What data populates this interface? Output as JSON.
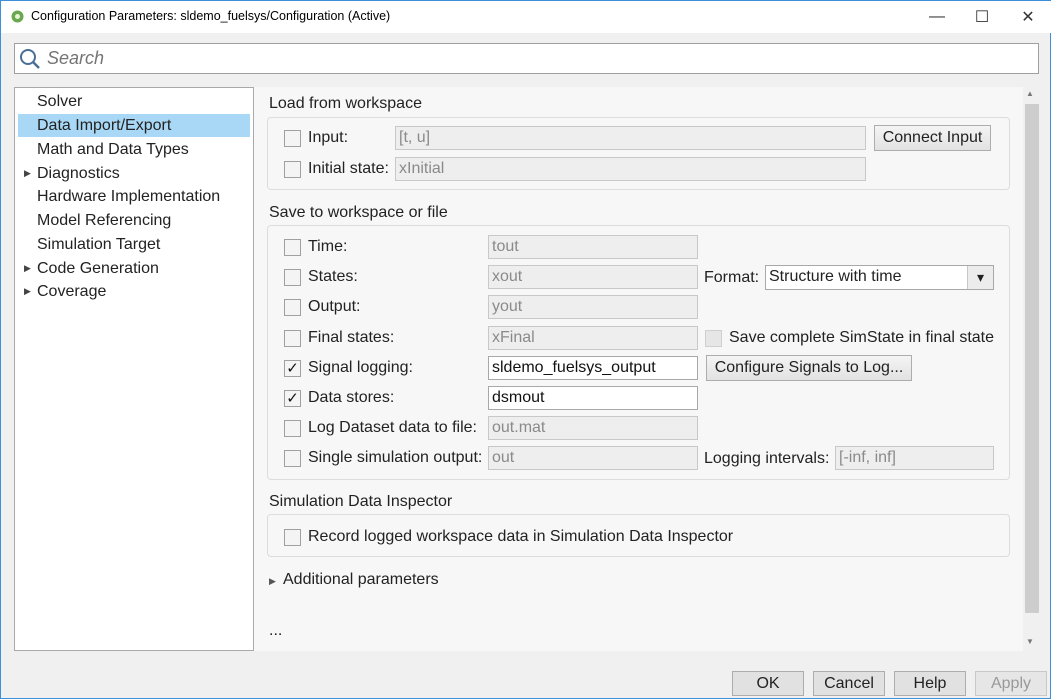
{
  "window": {
    "title": "Configuration Parameters: sldemo_fuelsys/Configuration (Active)",
    "minimize": "—",
    "maximize": "☐",
    "close": "✕"
  },
  "search": {
    "placeholder": "Search"
  },
  "tree": [
    {
      "label": "Solver",
      "arrow": ""
    },
    {
      "label": "Data Import/Export",
      "arrow": "",
      "selected": true
    },
    {
      "label": "Math and Data Types",
      "arrow": ""
    },
    {
      "label": "Diagnostics",
      "arrow": "▶"
    },
    {
      "label": "Hardware Implementation",
      "arrow": ""
    },
    {
      "label": "Model Referencing",
      "arrow": ""
    },
    {
      "label": "Simulation Target",
      "arrow": ""
    },
    {
      "label": "Code Generation",
      "arrow": "▶"
    },
    {
      "label": "Coverage",
      "arrow": "▶"
    }
  ],
  "load": {
    "title": "Load from workspace",
    "input": {
      "label": "Input:",
      "value": "[t, u]",
      "checked": false
    },
    "initial": {
      "label": "Initial state:",
      "value": "xInitial",
      "checked": false
    },
    "connect_button": "Connect Input"
  },
  "save": {
    "title": "Save to workspace or file",
    "rows": [
      {
        "label": "Time:",
        "value": "tout",
        "checked": false,
        "enabled": false,
        "mark": ""
      },
      {
        "label": "States:",
        "value": "xout",
        "checked": false,
        "enabled": false,
        "mark": ""
      },
      {
        "label": "Output:",
        "value": "yout",
        "checked": false,
        "enabled": false,
        "mark": ""
      },
      {
        "label": "Final states:",
        "value": "xFinal",
        "checked": false,
        "enabled": false,
        "mark": ""
      },
      {
        "label": "Signal logging:",
        "value": "sldemo_fuelsys_output",
        "checked": true,
        "enabled": true,
        "mark": "✓"
      },
      {
        "label": "Data stores:",
        "value": "dsmout",
        "checked": true,
        "enabled": true,
        "mark": "✓"
      },
      {
        "label": "Log Dataset data to file:",
        "value": "out.mat",
        "checked": false,
        "enabled": false,
        "mark": ""
      },
      {
        "label": "Single simulation output:",
        "value": "out",
        "checked": false,
        "enabled": false,
        "mark": ""
      }
    ],
    "format_label": "Format:",
    "format_value": "Structure with time",
    "format_arrow": "▾",
    "simstate_label": "Save complete SimState in final state",
    "configure_button": "Configure Signals to Log...",
    "logging_label": "Logging intervals:",
    "logging_value": "[-inf, inf]"
  },
  "sdi": {
    "title": "Simulation Data Inspector",
    "record_label": "Record logged workspace data in Simulation Data Inspector"
  },
  "additional": {
    "arrow": "▶",
    "label": "Additional parameters"
  },
  "ellipsis": "...",
  "buttons": {
    "ok": "OK",
    "cancel": "Cancel",
    "help": "Help",
    "apply": "Apply"
  },
  "scroll": {
    "up": "▲",
    "down": "▼"
  }
}
